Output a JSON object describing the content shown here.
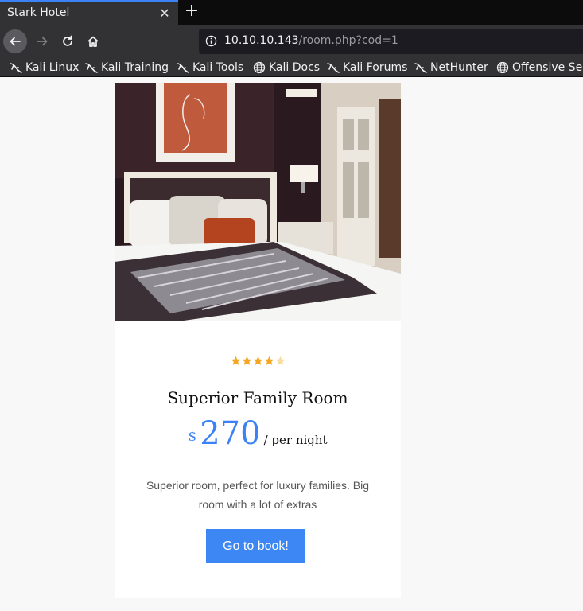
{
  "browser": {
    "tab_title": "Stark Hotel",
    "url_host": "10.10.10.143",
    "url_path": "/room.php?cod=1",
    "bookmarks": [
      "Kali Linux",
      "Kali Training",
      "Kali Tools",
      "Kali Docs",
      "Kali Forums",
      "NetHunter",
      "Offensive Security"
    ]
  },
  "room": {
    "rating": 4,
    "rating_max": 5,
    "title": "Superior Family Room",
    "currency": "$",
    "price": "270",
    "per": "/ per night",
    "description": "Superior room, perfect for luxury families. Big room with a lot of extras",
    "book_label": "Go to book!"
  },
  "colors": {
    "accent": "#3b82f6",
    "star": "#f5a623",
    "star_empty": "#fbdca0"
  }
}
